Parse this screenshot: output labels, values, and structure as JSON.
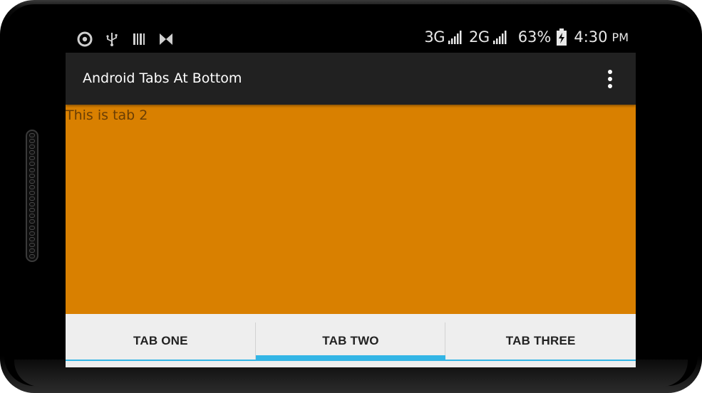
{
  "status_bar": {
    "left_icons": [
      "at-icon",
      "usb-icon",
      "barcode-icon",
      "bowtie-icon"
    ],
    "network_1": "3G",
    "network_2": "2G",
    "battery_percent": "63%",
    "time": "4:30",
    "ampm": "PM"
  },
  "action_bar": {
    "title": "Android Tabs At Bottom",
    "overflow_icon": "overflow-menu-icon"
  },
  "content": {
    "text": "This is tab 2",
    "background_color": "#d98000"
  },
  "tabs": [
    {
      "label": "TAB ONE",
      "selected": false
    },
    {
      "label": "TAB TWO",
      "selected": true
    },
    {
      "label": "TAB THREE",
      "selected": false
    }
  ],
  "colors": {
    "tab_indicator": "#33b5e5",
    "action_bar": "#212121",
    "tab_bar": "#eeeeee"
  }
}
